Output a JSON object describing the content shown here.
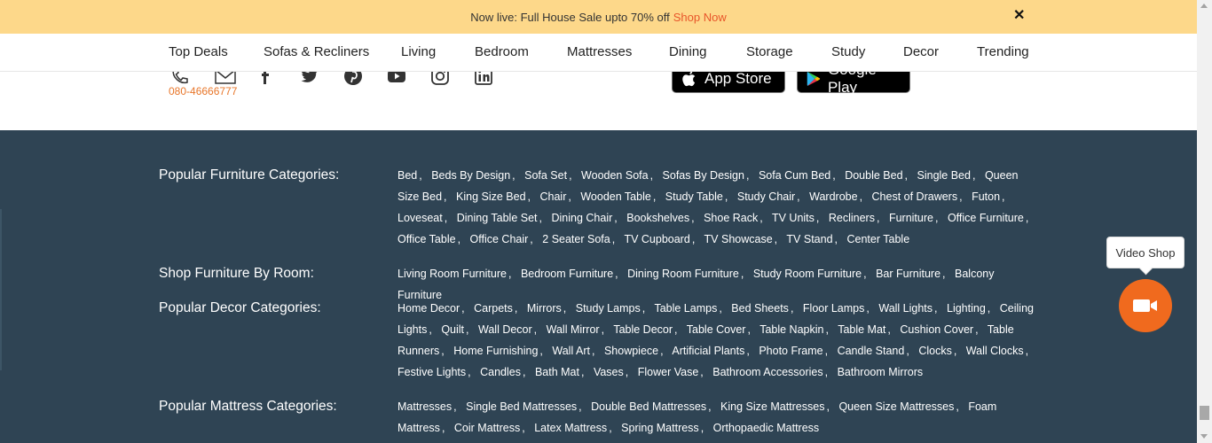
{
  "promo": {
    "text": "Now live: Full House Sale upto 70% off",
    "link": "Shop Now",
    "close": "✕"
  },
  "nav": {
    "items": [
      "Top Deals",
      "Sofas & Recliners",
      "Living",
      "Bedroom",
      "Mattresses",
      "Dining",
      "Storage",
      "Study",
      "Decor",
      "Trending"
    ]
  },
  "contact": {
    "phone": "080-46666777",
    "icons": [
      "phone-icon",
      "mail-icon",
      "facebook-icon",
      "twitter-icon",
      "pinterest-icon",
      "youtube-icon",
      "instagram-icon",
      "linkedin-icon"
    ]
  },
  "apps": {
    "app_store": "App Store",
    "google_play": "Google Play"
  },
  "footer": {
    "sections": [
      {
        "title": "Popular Furniture Categories:",
        "links": [
          "Bed",
          "Beds By Design",
          "Sofa Set",
          "Wooden Sofa",
          "Sofas By Design",
          "Sofa Cum Bed",
          "Double Bed",
          "Single Bed",
          "Queen Size Bed",
          "King Size Bed",
          "Chair",
          "Wooden Table",
          "Study Table",
          "Study Chair",
          "Wardrobe",
          "Chest of Drawers",
          "Futon",
          "Loveseat",
          "Dining Table Set",
          "Dining Chair",
          "Bookshelves",
          "Shoe Rack",
          "TV Units",
          "Recliners",
          "Furniture",
          "Office Furniture",
          "Office Table",
          "Office Chair",
          "2 Seater Sofa",
          "TV Cupboard",
          "TV Showcase",
          "TV Stand",
          "Center Table"
        ]
      },
      {
        "title": "Shop Furniture By Room:",
        "links": [
          "Living Room Furniture",
          "Bedroom Furniture",
          "Dining Room Furniture",
          "Study Room Furniture",
          "Bar Furniture",
          "Balcony Furniture"
        ]
      },
      {
        "title": "Popular Decor Categories:",
        "links": [
          "Home Decor",
          "Carpets",
          "Mirrors",
          "Study Lamps",
          "Table Lamps",
          "Bed Sheets",
          "Floor Lamps",
          "Wall Lights",
          "Lighting",
          "Ceiling Lights",
          "Quilt",
          "Wall Decor",
          "Wall Mirror",
          "Table Decor",
          "Table Cover",
          "Table Napkin",
          "Table Mat",
          "Cushion Cover",
          "Table Runners",
          "Home Furnishing",
          "Wall Art",
          "Showpiece",
          "Artificial Plants",
          "Photo Frame",
          "Candle Stand",
          "Clocks",
          "Wall Clocks",
          "Festive Lights",
          "Candles",
          "Bath Mat",
          "Vases",
          "Flower Vase",
          "Bathroom Accessories",
          "Bathroom Mirrors"
        ]
      },
      {
        "title": "Popular Mattress Categories:",
        "links": [
          "Mattresses",
          "Single Bed Mattresses",
          "Double Bed Mattresses",
          "King Size Mattresses",
          "Queen Size Mattresses",
          "Foam Mattress",
          "Coir Mattress",
          "Latex Mattress",
          "Spring Mattress",
          "Orthopaedic Mattress"
        ]
      }
    ]
  },
  "video_shop": {
    "label": "Video Shop"
  },
  "colors": {
    "banner_bg": "#fdd88a",
    "accent": "#e8562a",
    "footer_bg": "#2f4454",
    "video_button": "#f06a1e"
  }
}
